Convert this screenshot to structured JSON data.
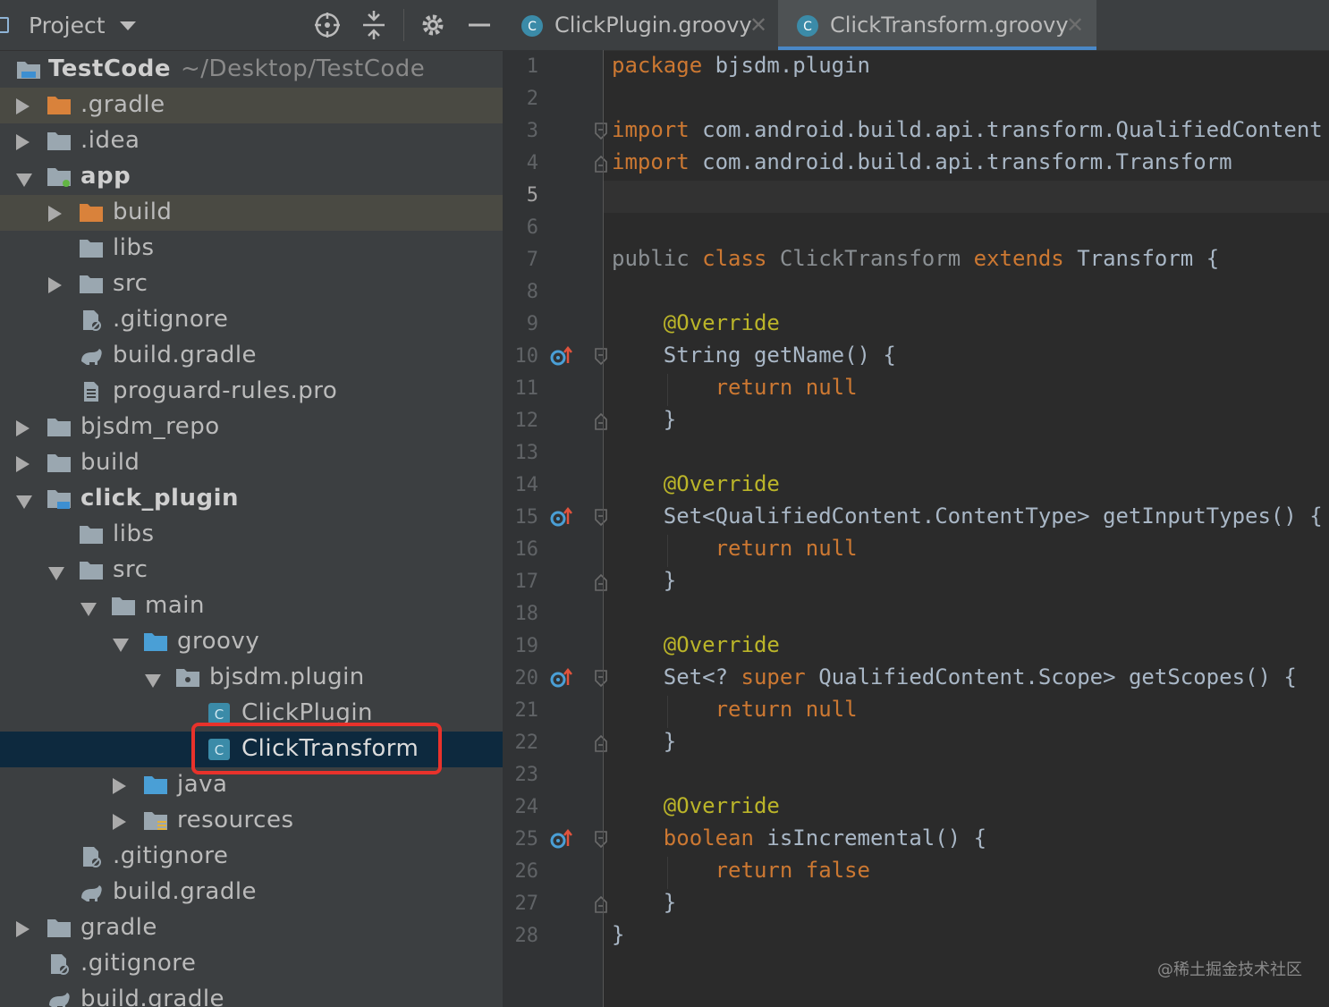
{
  "project": {
    "title": "Project",
    "root_name": "TestCode",
    "root_path": "~/Desktop/TestCode",
    "tree": [
      {
        "label": ".gradle",
        "indent": 0,
        "arrow": "right",
        "icon": "folder-orange",
        "bold": false,
        "highlight": "file"
      },
      {
        "label": ".idea",
        "indent": 0,
        "arrow": "right",
        "icon": "folder",
        "bold": false
      },
      {
        "label": "app",
        "indent": 0,
        "arrow": "down",
        "icon": "module-folder",
        "bold": true
      },
      {
        "label": "build",
        "indent": 1,
        "arrow": "right",
        "icon": "folder-orange",
        "bold": false,
        "highlight": "file"
      },
      {
        "label": "libs",
        "indent": 1,
        "arrow": "none",
        "icon": "folder",
        "bold": false
      },
      {
        "label": "src",
        "indent": 1,
        "arrow": "right",
        "icon": "folder",
        "bold": false
      },
      {
        "label": ".gitignore",
        "indent": 1,
        "arrow": "none",
        "icon": "gitignore-file",
        "bold": false
      },
      {
        "label": "build.gradle",
        "indent": 1,
        "arrow": "none",
        "icon": "gradle-file",
        "bold": false
      },
      {
        "label": "proguard-rules.pro",
        "indent": 1,
        "arrow": "none",
        "icon": "text-file",
        "bold": false
      },
      {
        "label": "bjsdm_repo",
        "indent": 0,
        "arrow": "right",
        "icon": "folder",
        "bold": false
      },
      {
        "label": "build",
        "indent": 0,
        "arrow": "right",
        "icon": "folder",
        "bold": false
      },
      {
        "label": "click_plugin",
        "indent": 0,
        "arrow": "down",
        "icon": "module-folder-blue",
        "bold": true
      },
      {
        "label": "libs",
        "indent": 1,
        "arrow": "none",
        "icon": "folder",
        "bold": false
      },
      {
        "label": "src",
        "indent": 1,
        "arrow": "down",
        "icon": "folder",
        "bold": false
      },
      {
        "label": "main",
        "indent": 2,
        "arrow": "down",
        "icon": "folder",
        "bold": false
      },
      {
        "label": "groovy",
        "indent": 3,
        "arrow": "down",
        "icon": "source-folder",
        "bold": false
      },
      {
        "label": "bjsdm.plugin",
        "indent": 4,
        "arrow": "down",
        "icon": "package-folder",
        "bold": false
      },
      {
        "label": "ClickPlugin",
        "indent": 5,
        "arrow": "none",
        "icon": "groovy-class",
        "bold": false
      },
      {
        "label": "ClickTransform",
        "indent": 5,
        "arrow": "none",
        "icon": "groovy-class",
        "bold": false,
        "highlight": "selected"
      },
      {
        "label": "java",
        "indent": 3,
        "arrow": "right",
        "icon": "source-folder",
        "bold": false
      },
      {
        "label": "resources",
        "indent": 3,
        "arrow": "right",
        "icon": "resources-folder",
        "bold": false
      },
      {
        "label": ".gitignore",
        "indent": 1,
        "arrow": "none",
        "icon": "gitignore-file",
        "bold": false
      },
      {
        "label": "build.gradle",
        "indent": 1,
        "arrow": "none",
        "icon": "gradle-file",
        "bold": false
      },
      {
        "label": "gradle",
        "indent": 0,
        "arrow": "right",
        "icon": "folder",
        "bold": false
      },
      {
        "label": ".gitignore",
        "indent": 0,
        "arrow": "none",
        "icon": "gitignore-file",
        "bold": false
      },
      {
        "label": "build.gradle",
        "indent": 0,
        "arrow": "none",
        "icon": "gradle-file",
        "bold": false
      }
    ]
  },
  "tabs": [
    {
      "label": "ClickPlugin.groovy",
      "active": false
    },
    {
      "label": "ClickTransform.groovy",
      "active": true
    }
  ],
  "editor": {
    "current_line": 5,
    "lines": [
      [
        [
          "kw",
          "package"
        ],
        [
          "t",
          " bjsdm.plugin"
        ]
      ],
      [],
      [
        [
          "kw",
          "import"
        ],
        [
          "t",
          " com.android.build.api.transform.QualifiedContent"
        ]
      ],
      [
        [
          "kw",
          "import"
        ],
        [
          "t",
          " com.android.build.api.transform.Transform"
        ]
      ],
      [],
      [],
      [
        [
          "dim",
          "public "
        ],
        [
          "kw",
          "class "
        ],
        [
          "dim",
          "ClickTransform "
        ],
        [
          "kw",
          "extends "
        ],
        [
          "t",
          "Transform {"
        ]
      ],
      [],
      [
        [
          "t",
          "    "
        ],
        [
          "ann",
          "@Override"
        ]
      ],
      [
        [
          "t",
          "    String getName() {"
        ]
      ],
      [
        [
          "t",
          "        "
        ],
        [
          "kw",
          "return null"
        ]
      ],
      [
        [
          "t",
          "    }"
        ]
      ],
      [],
      [
        [
          "t",
          "    "
        ],
        [
          "ann",
          "@Override"
        ]
      ],
      [
        [
          "t",
          "    Set<QualifiedContent.ContentType> getInputTypes() {"
        ]
      ],
      [
        [
          "t",
          "        "
        ],
        [
          "kw",
          "return null"
        ]
      ],
      [
        [
          "t",
          "    }"
        ]
      ],
      [],
      [
        [
          "t",
          "    "
        ],
        [
          "ann",
          "@Override"
        ]
      ],
      [
        [
          "t",
          "    Set<? "
        ],
        [
          "kw",
          "super "
        ],
        [
          "t",
          "QualifiedContent.Scope> getScopes() {"
        ]
      ],
      [
        [
          "t",
          "        "
        ],
        [
          "kw",
          "return null"
        ]
      ],
      [
        [
          "t",
          "    }"
        ]
      ],
      [],
      [
        [
          "t",
          "    "
        ],
        [
          "ann",
          "@Override"
        ]
      ],
      [
        [
          "t",
          "    "
        ],
        [
          "kw",
          "boolean "
        ],
        [
          "t",
          "isIncremental() {"
        ]
      ],
      [
        [
          "t",
          "        "
        ],
        [
          "kw",
          "return false"
        ]
      ],
      [
        [
          "t",
          "    }"
        ]
      ],
      [
        [
          "t",
          "}"
        ]
      ]
    ],
    "override_lines": [
      10,
      15,
      20,
      25
    ],
    "fold_open_lines": [
      3,
      10,
      15,
      20,
      25
    ],
    "fold_close_lines": [
      4,
      12,
      17,
      22,
      27
    ]
  },
  "watermark": "@稀土掘金技术社区",
  "colors": {
    "keyword": "#cc7832",
    "annotation": "#bbb529",
    "text": "#a9b7c6",
    "selection": "#0d293e",
    "highlight_box": "#e8322b"
  }
}
